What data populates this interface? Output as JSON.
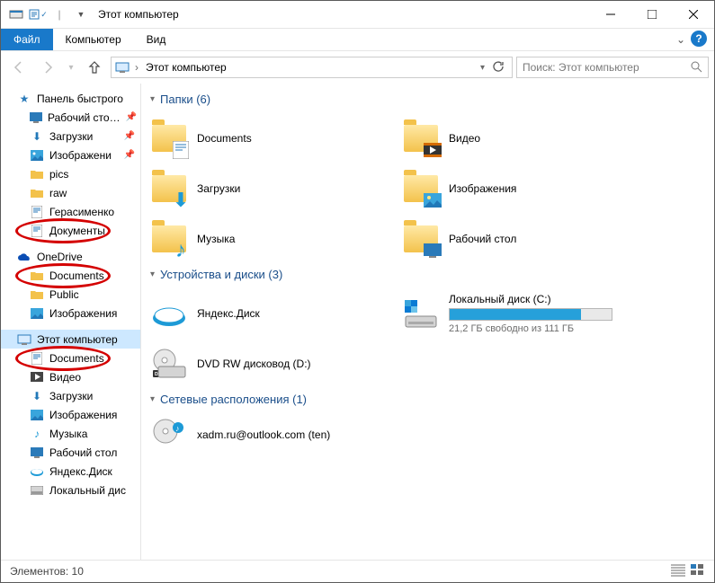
{
  "window": {
    "title": "Этот компьютер"
  },
  "ribbon": {
    "file": "Файл",
    "computer": "Компьютер",
    "view": "Вид"
  },
  "breadcrumb": {
    "location": "Этот компьютер"
  },
  "search": {
    "placeholder": "Поиск: Этот компьютер"
  },
  "sidebar": {
    "quick": "Панель быстрого",
    "desktop": "Рабочий сто…",
    "downloads": "Загрузки",
    "pictures": "Изображени",
    "pics": "pics",
    "raw": "raw",
    "gerasimenko": "Герасименко",
    "documents_ru": "Документы",
    "onedrive": "OneDrive",
    "od_documents": "Documents",
    "od_public": "Public",
    "od_pictures": "Изображения",
    "this_pc": "Этот компьютер",
    "pc_documents": "Documents",
    "pc_video": "Видео",
    "pc_downloads": "Загрузки",
    "pc_pictures": "Изображения",
    "pc_music": "Музыка",
    "pc_desktop": "Рабочий стол",
    "pc_yandex": "Яндекс.Диск",
    "pc_local": "Локальный дис"
  },
  "groups": {
    "folders": "Папки (6)",
    "devices": "Устройства и диски (3)",
    "network": "Сетевые расположения (1)"
  },
  "folders": {
    "documents": "Documents",
    "video": "Видео",
    "downloads": "Загрузки",
    "pictures": "Изображения",
    "music": "Музыка",
    "desktop": "Рабочий стол"
  },
  "devices": {
    "yandex": "Яндекс.Диск",
    "local_name": "Локальный диск (C:)",
    "local_free": "21,2 ГБ свободно из 111 ГБ",
    "local_fill_pct": 81,
    "dvd": "DVD RW дисковод (D:)"
  },
  "network": {
    "account": "xadm.ru@outlook.com (ten)"
  },
  "status": {
    "count": "Элементов: 10"
  }
}
